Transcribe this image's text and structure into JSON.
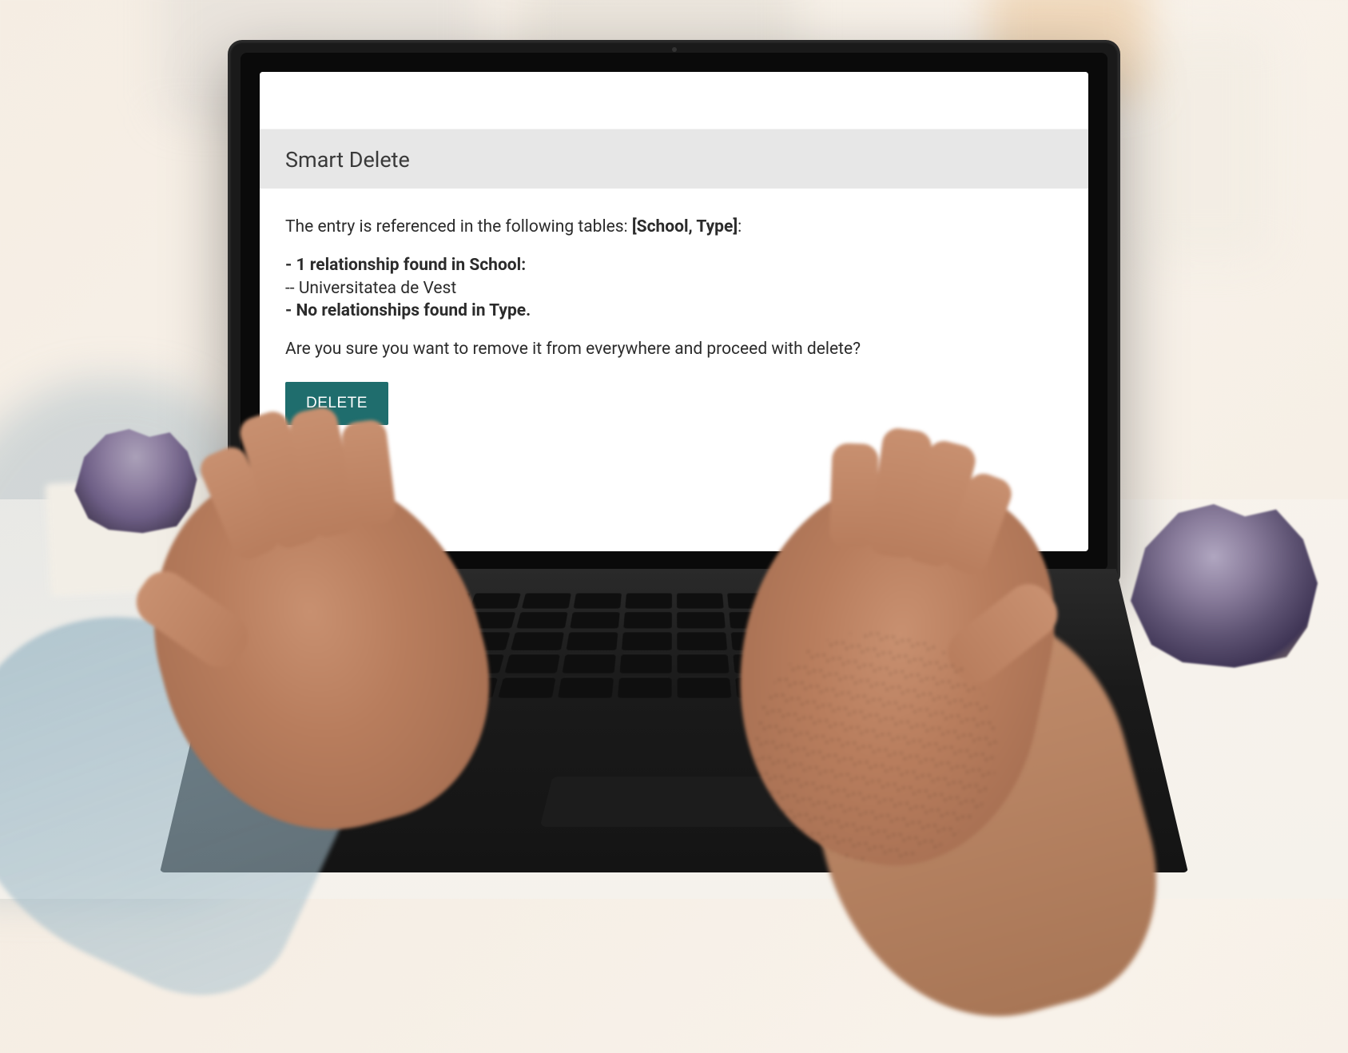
{
  "panel": {
    "title": "Smart Delete",
    "referenced_prefix": "The entry is referenced in the following tables: ",
    "referenced_tables": "[School, Type]",
    "colon": ":",
    "relationships": {
      "line1": "- 1 relationship found in School:",
      "line2": "-- Universitatea de Vest",
      "line3": "- No relationships found in Type."
    },
    "confirm_text": "Are you sure you want to remove it from everywhere and proceed with delete?",
    "button_label": "DELETE"
  },
  "colors": {
    "button_bg": "#1f6d6d",
    "header_bg": "#e7e7e7"
  }
}
